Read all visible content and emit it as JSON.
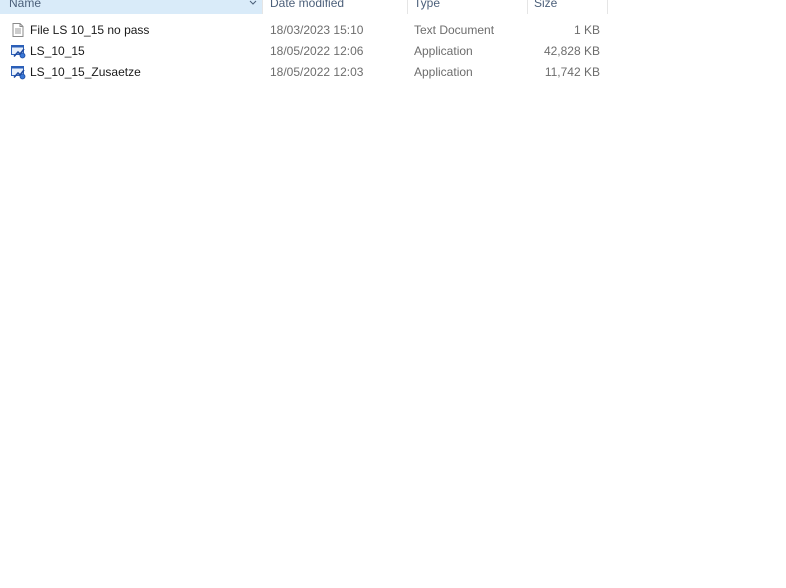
{
  "columns": {
    "name": "Name",
    "date_modified": "Date modified",
    "type": "Type",
    "size": "Size"
  },
  "files": [
    {
      "name": "File LS 10_15 no pass",
      "date_modified": "18/03/2023 15:10",
      "type": "Text Document",
      "size": "1 KB",
      "icon": "text-document-icon"
    },
    {
      "name": "LS_10_15",
      "date_modified": "18/05/2022 12:06",
      "type": "Application",
      "size": "42,828 KB",
      "icon": "application-icon"
    },
    {
      "name": "LS_10_15_Zusaetze",
      "date_modified": "18/05/2022 12:03",
      "type": "Application",
      "size": "11,742 KB",
      "icon": "application-icon"
    }
  ],
  "colors": {
    "header_selected": "#d9ebf9",
    "header_text": "#4c607a",
    "secondary_text": "#6d6d6d"
  }
}
